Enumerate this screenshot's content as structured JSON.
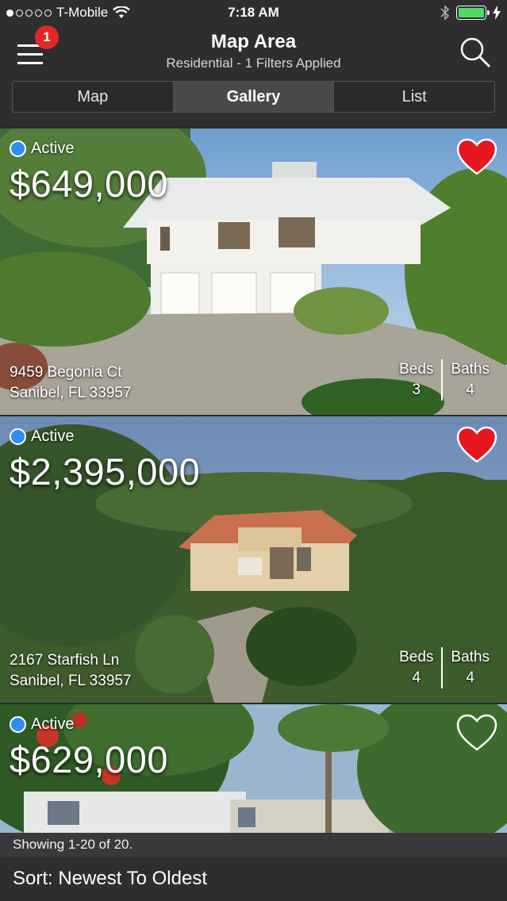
{
  "status_bar": {
    "carrier": "T-Mobile",
    "time": "7:18 AM"
  },
  "header": {
    "title": "Map Area",
    "subtitle": "Residential - 1 Filters Applied",
    "notification_count": "1",
    "tabs": [
      {
        "label": "Map",
        "active": false
      },
      {
        "label": "Gallery",
        "active": true
      },
      {
        "label": "List",
        "active": false
      }
    ]
  },
  "listings": [
    {
      "status": "Active",
      "price": "$649,000",
      "address_line1": "9459 Begonia Ct",
      "address_line2": "Sanibel, FL 33957",
      "beds_label": "Beds",
      "beds": "3",
      "baths_label": "Baths",
      "baths": "4",
      "favorited": true
    },
    {
      "status": "Active",
      "price": "$2,395,000",
      "address_line1": "2167 Starfish Ln",
      "address_line2": "Sanibel, FL 33957",
      "beds_label": "Beds",
      "beds": "4",
      "baths_label": "Baths",
      "baths": "4",
      "favorited": true
    },
    {
      "status": "Active",
      "price": "$629,000",
      "favorited": false
    }
  ],
  "footer": {
    "showing": "Showing 1-20 of 20.",
    "sort": "Sort: Newest To Oldest"
  },
  "colors": {
    "favorite_red": "#e8171f",
    "active_blue": "#2e8ef0",
    "badge_red": "#e22626",
    "battery_green": "#4cd964"
  }
}
